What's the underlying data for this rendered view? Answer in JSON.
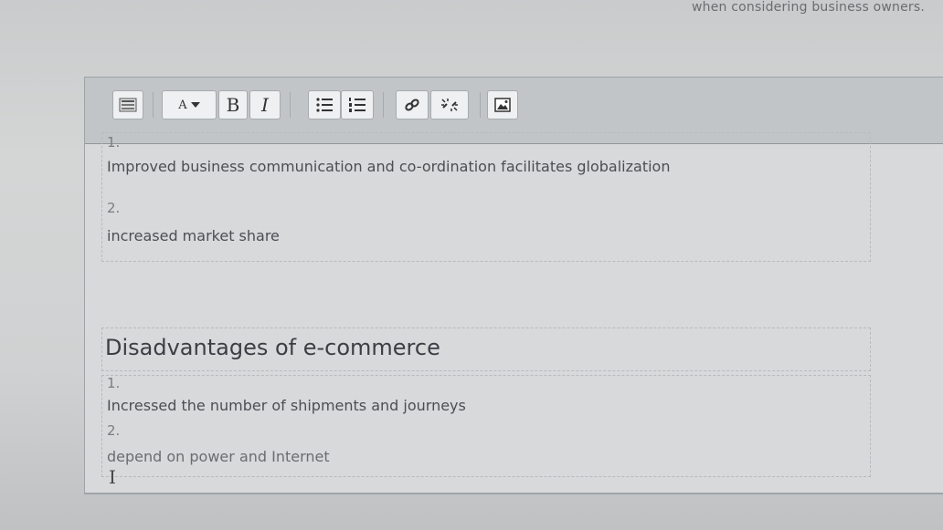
{
  "prompt_fragment": "when considering business owners.",
  "toolbar": {
    "buttons": [
      {
        "id": "toggle",
        "icon": "toolbar-toggle-icon"
      },
      {
        "id": "font-size",
        "icon": "font-size-icon",
        "label": "A"
      },
      {
        "id": "bold",
        "label": "B"
      },
      {
        "id": "italic",
        "label": "I"
      },
      {
        "id": "bullet-list",
        "icon": "bullet-list-icon"
      },
      {
        "id": "numbered-list",
        "icon": "numbered-list-icon"
      },
      {
        "id": "link",
        "icon": "link-icon"
      },
      {
        "id": "unlink",
        "icon": "unlink-icon"
      },
      {
        "id": "image",
        "icon": "image-icon"
      }
    ]
  },
  "content": {
    "advantages": [
      {
        "num": "1.",
        "text": "Improved business communication and co-ordination facilitates globalization"
      },
      {
        "num": "2.",
        "text": "increased market share"
      }
    ],
    "disadvantages_heading": "Disadvantages of e-commerce",
    "disadvantages": [
      {
        "num": "1.",
        "text": "Incressed the number of shipments and journeys"
      },
      {
        "num": "2.",
        "text": "depend on power and Internet"
      }
    ]
  },
  "cursor_glyph": "I"
}
